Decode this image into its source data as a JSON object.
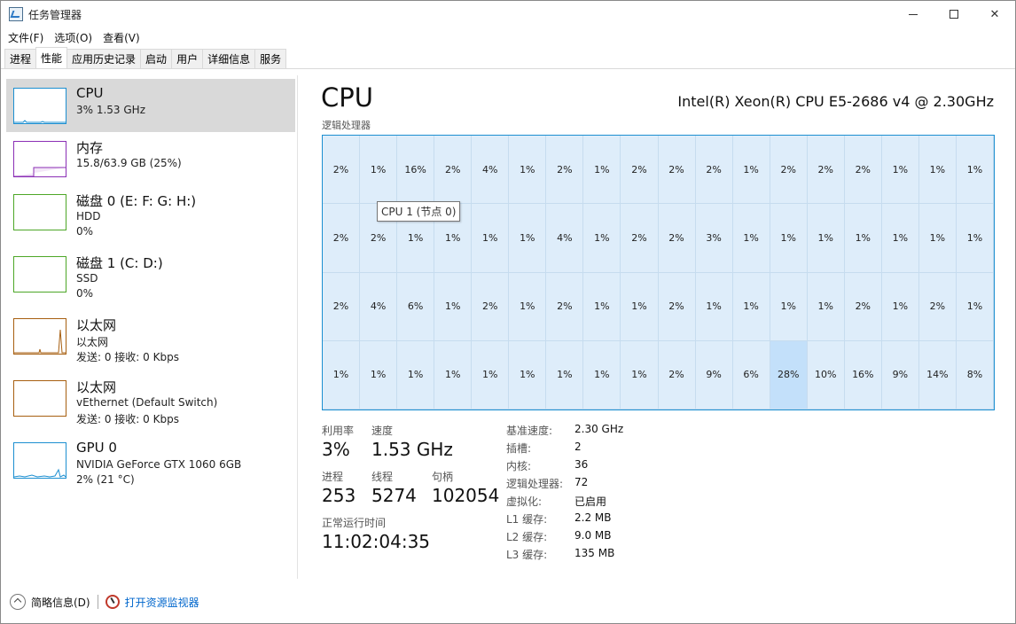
{
  "window": {
    "title": "任务管理器"
  },
  "menu": [
    "文件(F)",
    "选项(O)",
    "查看(V)"
  ],
  "tabs": [
    "进程",
    "性能",
    "应用历史记录",
    "启动",
    "用户",
    "详细信息",
    "服务"
  ],
  "active_tab": 1,
  "sidebar": [
    {
      "name": "CPU",
      "sub1": "3% 1.53 GHz",
      "sub2": "",
      "color": "#1c8fd1"
    },
    {
      "name": "内存",
      "sub1": "15.8/63.9 GB (25%)",
      "sub2": "",
      "color": "#8b2fb5"
    },
    {
      "name": "磁盘 0 (E: F: G: H:)",
      "sub1": "HDD",
      "sub2": "0%",
      "color": "#4da727"
    },
    {
      "name": "磁盘 1 (C: D:)",
      "sub1": "SSD",
      "sub2": "0%",
      "color": "#4da727"
    },
    {
      "name": "以太网",
      "sub1": "以太网",
      "sub2": "发送: 0 接收: 0 Kbps",
      "color": "#a75f10"
    },
    {
      "name": "以太网",
      "sub1": "vEthernet (Default Switch)",
      "sub2": "发送: 0 接收: 0 Kbps",
      "color": "#a75f10"
    },
    {
      "name": "GPU 0",
      "sub1": "NVIDIA GeForce GTX 1060 6GB",
      "sub2": "2% (21 °C)",
      "color": "#1c8fd1"
    }
  ],
  "main": {
    "title": "CPU",
    "model": "Intel(R) Xeon(R) CPU E5-2686 v4 @ 2.30GHz",
    "grid_label": "逻辑处理器",
    "tooltip": "CPU 1 (节点 0)",
    "cores": [
      [
        "2%",
        "1%",
        "16%",
        "2%",
        "4%",
        "1%",
        "2%",
        "1%",
        "2%",
        "2%",
        "2%",
        "1%",
        "2%",
        "2%",
        "2%",
        "1%",
        "1%",
        "1%"
      ],
      [
        "2%",
        "2%",
        "1%",
        "1%",
        "1%",
        "1%",
        "4%",
        "1%",
        "2%",
        "2%",
        "3%",
        "1%",
        "1%",
        "1%",
        "1%",
        "1%",
        "1%",
        "1%"
      ],
      [
        "2%",
        "4%",
        "6%",
        "1%",
        "2%",
        "1%",
        "2%",
        "1%",
        "1%",
        "2%",
        "1%",
        "1%",
        "1%",
        "1%",
        "2%",
        "1%",
        "2%",
        "1%"
      ],
      [
        "1%",
        "1%",
        "1%",
        "1%",
        "1%",
        "1%",
        "1%",
        "1%",
        "1%",
        "2%",
        "9%",
        "6%",
        "28%",
        "10%",
        "16%",
        "9%",
        "14%",
        "8%"
      ]
    ]
  },
  "stats": {
    "util_label": "利用率",
    "util_value": "3%",
    "speed_label": "速度",
    "speed_value": "1.53 GHz",
    "proc_label": "进程",
    "proc_value": "253",
    "thread_label": "线程",
    "thread_value": "5274",
    "handle_label": "句柄",
    "handle_value": "102054",
    "uptime_label": "正常运行时间",
    "uptime_value": "11:02:04:35"
  },
  "specs": [
    {
      "k": "基准速度:",
      "v": "2.30 GHz"
    },
    {
      "k": "插槽:",
      "v": "2"
    },
    {
      "k": "内核:",
      "v": "36"
    },
    {
      "k": "逻辑处理器:",
      "v": "72"
    },
    {
      "k": "虚拟化:",
      "v": "已启用"
    },
    {
      "k": "L1 缓存:",
      "v": "2.2 MB"
    },
    {
      "k": "L2 缓存:",
      "v": "9.0 MB"
    },
    {
      "k": "L3 缓存:",
      "v": "135 MB"
    }
  ],
  "footer": {
    "fewer": "简略信息(D)",
    "resmon": "打开资源监视器"
  }
}
